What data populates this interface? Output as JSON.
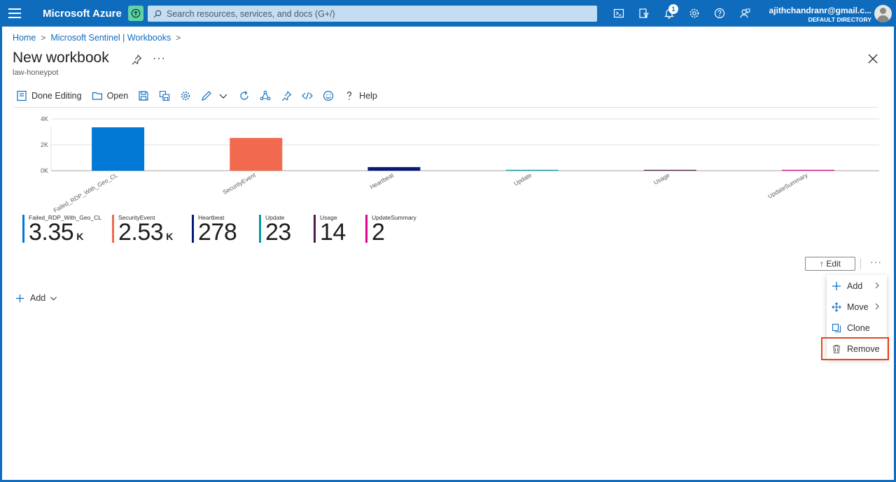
{
  "topbar": {
    "brand": "Microsoft Azure",
    "search_placeholder": "Search resources, services, and docs (G+/)",
    "notification_count": "1",
    "account_email": "ajithchandranr@gmail.c...",
    "account_directory": "DEFAULT DIRECTORY"
  },
  "breadcrumb": {
    "items": [
      "Home",
      "Microsoft Sentinel | Workbooks"
    ]
  },
  "page": {
    "title": "New workbook",
    "subtitle": "law-honeypot"
  },
  "toolbar": {
    "done_editing": "Done Editing",
    "open": "Open",
    "help": "Help"
  },
  "chart_data": {
    "type": "bar",
    "categories": [
      "Failed_RDP_With_Geo_CL",
      "SecurityEvent",
      "Heartbeat",
      "Update",
      "Usage",
      "UpdateSummary"
    ],
    "values": [
      3350,
      2530,
      278,
      23,
      14,
      2
    ],
    "colors": [
      "#0078d4",
      "#f1694f",
      "#061a7a",
      "#009ba0",
      "#4d1b4b",
      "#e3008c"
    ],
    "yticks": [
      "0K",
      "2K",
      "4K"
    ],
    "ylim": [
      0,
      4000
    ]
  },
  "tiles": [
    {
      "label": "Failed_RDP_With_Geo_CL",
      "value": "3.35",
      "unit": "K",
      "color": "#0078d4"
    },
    {
      "label": "SecurityEvent",
      "value": "2.53",
      "unit": "K",
      "color": "#f1694f"
    },
    {
      "label": "Heartbeat",
      "value": "278",
      "unit": "",
      "color": "#061a7a"
    },
    {
      "label": "Update",
      "value": "23",
      "unit": "",
      "color": "#009ba0"
    },
    {
      "label": "Usage",
      "value": "14",
      "unit": "",
      "color": "#4d1b4b"
    },
    {
      "label": "UpdateSummary",
      "value": "2",
      "unit": "",
      "color": "#e3008c"
    }
  ],
  "edit_button": "↑ Edit",
  "add_label": "Add",
  "context_menu": {
    "add": "Add",
    "move": "Move",
    "clone": "Clone",
    "remove": "Remove"
  }
}
